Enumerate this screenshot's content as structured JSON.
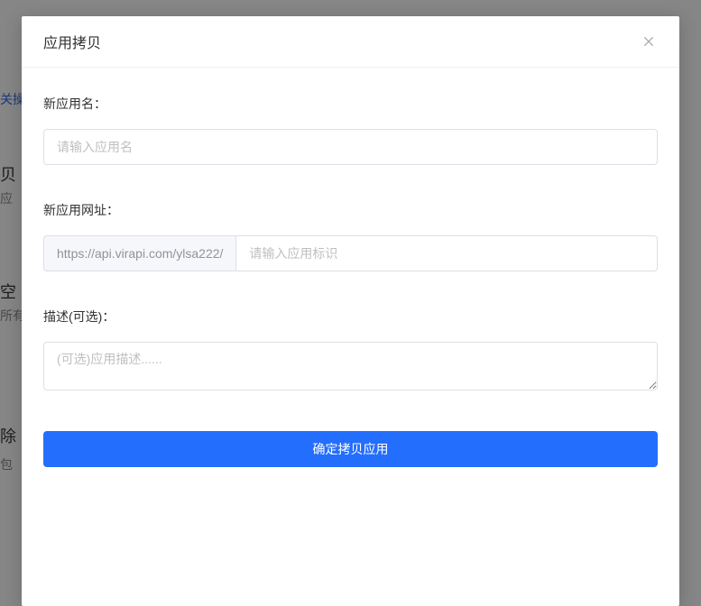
{
  "modal": {
    "title": "应用拷贝",
    "fields": {
      "name": {
        "label": "新应用名：",
        "placeholder": "请输入应用名",
        "value": ""
      },
      "url": {
        "label": "新应用网址：",
        "prefix": "https://api.virapi.com/ylsa222/",
        "placeholder": "请输入应用标识",
        "value": ""
      },
      "description": {
        "label": "描述(可选)：",
        "placeholder": "(可选)应用描述......",
        "value": ""
      }
    },
    "submit_label": "确定拷贝应用"
  },
  "background": {
    "frag1": "关操",
    "frag2": "贝",
    "frag3": "应",
    "frag4": "空",
    "frag5": "所有",
    "frag6": "除",
    "frag7": "包"
  }
}
